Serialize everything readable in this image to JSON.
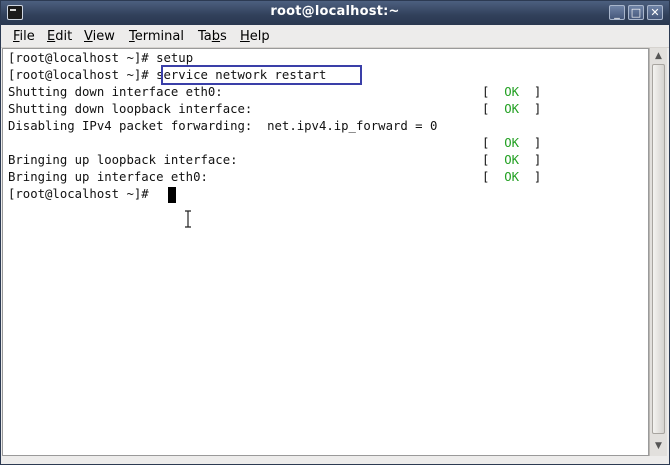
{
  "window": {
    "title": "root@localhost:~"
  },
  "menu": {
    "file": {
      "key": "F",
      "rest": "ile"
    },
    "edit": {
      "key": "E",
      "rest": "dit"
    },
    "view": {
      "key": "V",
      "rest": "iew"
    },
    "terminal": {
      "key": "T",
      "rest": "erminal"
    },
    "tabs": {
      "pre": "Ta",
      "key": "b",
      "rest": "s"
    },
    "help": {
      "key": "H",
      "rest": "elp"
    }
  },
  "terminal": {
    "prompt": "[root@localhost ~]# ",
    "cmd1": "setup",
    "cmd2": "service network restart",
    "line3": "Shutting down interface eth0:",
    "line4": "Shutting down loopback interface:",
    "line5": "Disabling IPv4 packet forwarding:  net.ipv4.ip_forward = 0",
    "line7": "Bringing up loopback interface:",
    "line8": "Bringing up interface eth0:",
    "status_open": "[  ",
    "status_ok": "OK",
    "status_close": "  ]"
  },
  "colors": {
    "ok": "#22a022",
    "highlight_border": "#3a3fa8",
    "titlebar": "#31405a"
  }
}
